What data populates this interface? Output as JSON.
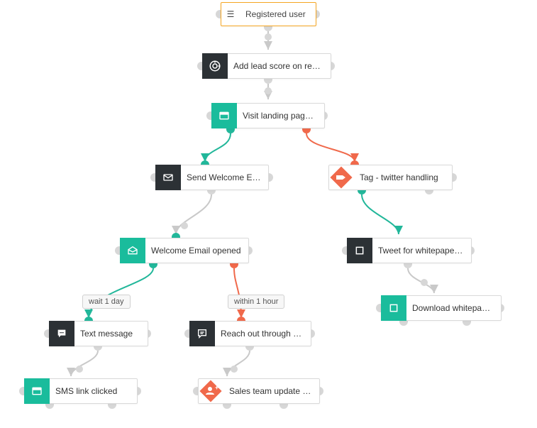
{
  "nodes": {
    "start": {
      "label": "Registered user"
    },
    "lead_score": {
      "label": "Add lead score on reg…"
    },
    "visit_landing": {
      "label": "Visit landing page, ap…"
    },
    "send_welcome": {
      "label": "Send Welcome Email"
    },
    "tag_twitter": {
      "label": "Tag - twitter handling"
    },
    "welcome_opened": {
      "label": "Welcome Email opened"
    },
    "tweet_wp": {
      "label": "Tweet for whitepaper …"
    },
    "download_wp": {
      "label": "Download whitepaper"
    },
    "text_msg": {
      "label": "Text message"
    },
    "reach_out": {
      "label": "Reach out through mu…"
    },
    "sms_clicked": {
      "label": "SMS link clicked"
    },
    "sales_update": {
      "label": "Sales team update for…"
    }
  },
  "pills": {
    "wait1day": "wait 1 day",
    "within1h": "within 1 hour"
  },
  "colors": {
    "teal": "#1abc9c",
    "orange": "#f0694b",
    "dark": "#2c3135",
    "edge_grey": "#c9c9c9",
    "start_border": "#f5a623"
  },
  "edges": [
    {
      "from": "start",
      "to": "lead_score",
      "kind": "default"
    },
    {
      "from": "lead_score",
      "to": "visit_landing",
      "kind": "default"
    },
    {
      "from": "visit_landing",
      "to": "send_welcome",
      "kind": "yes"
    },
    {
      "from": "visit_landing",
      "to": "tag_twitter",
      "kind": "no"
    },
    {
      "from": "send_welcome",
      "to": "welcome_opened",
      "kind": "default"
    },
    {
      "from": "tag_twitter",
      "to": "tweet_wp",
      "kind": "yes"
    },
    {
      "from": "tweet_wp",
      "to": "download_wp",
      "kind": "default"
    },
    {
      "from": "welcome_opened",
      "to": "text_msg",
      "kind": "yes",
      "label": "wait 1 day"
    },
    {
      "from": "welcome_opened",
      "to": "reach_out",
      "kind": "no",
      "label": "within 1 hour"
    },
    {
      "from": "text_msg",
      "to": "sms_clicked",
      "kind": "default"
    },
    {
      "from": "reach_out",
      "to": "sales_update",
      "kind": "default"
    }
  ]
}
